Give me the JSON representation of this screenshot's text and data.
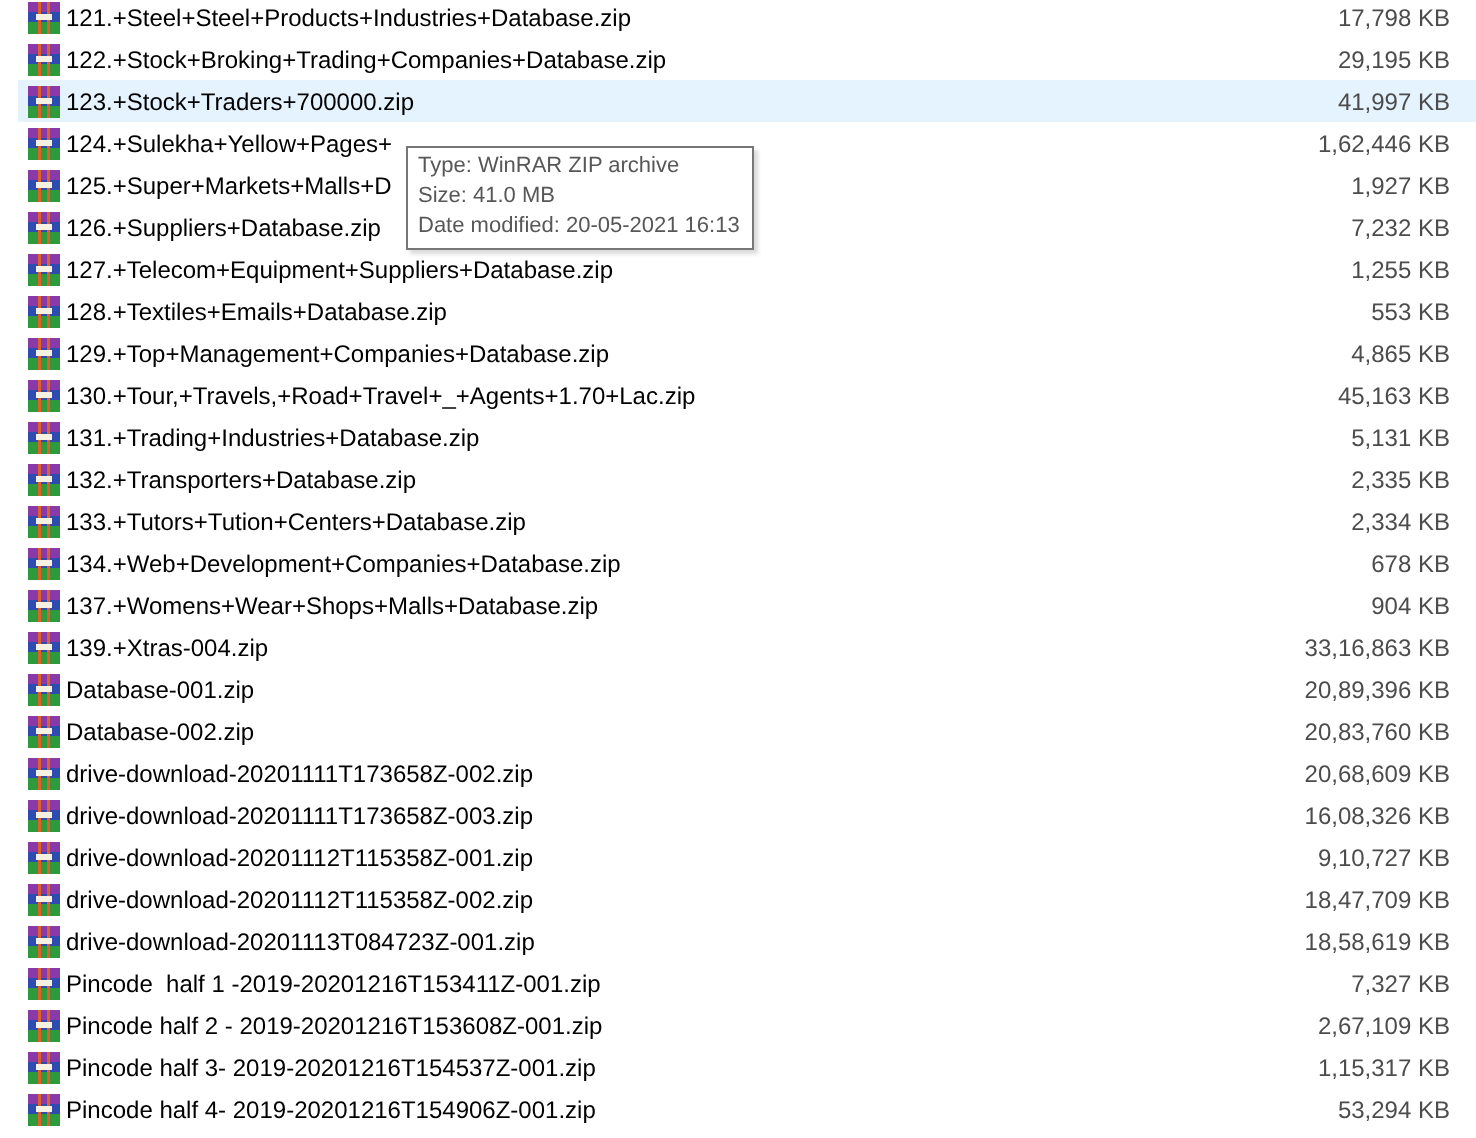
{
  "files": [
    {
      "name": "121.+Steel+Steel+Products+Industries+Database.zip",
      "size": "17,798 KB",
      "selected": false
    },
    {
      "name": "122.+Stock+Broking+Trading+Companies+Database.zip",
      "size": "29,195 KB",
      "selected": false
    },
    {
      "name": "123.+Stock+Traders+700000.zip",
      "size": "41,997 KB",
      "selected": true
    },
    {
      "name": "124.+Sulekha+Yellow+Pages+",
      "size": "1,62,446 KB",
      "selected": false
    },
    {
      "name": "125.+Super+Markets+Malls+D",
      "size": "1,927 KB",
      "selected": false
    },
    {
      "name": "126.+Suppliers+Database.zip",
      "size": "7,232 KB",
      "selected": false
    },
    {
      "name": "127.+Telecom+Equipment+Suppliers+Database.zip",
      "size": "1,255 KB",
      "selected": false
    },
    {
      "name": "128.+Textiles+Emails+Database.zip",
      "size": "553 KB",
      "selected": false
    },
    {
      "name": "129.+Top+Management+Companies+Database.zip",
      "size": "4,865 KB",
      "selected": false
    },
    {
      "name": "130.+Tour,+Travels,+Road+Travel+_+Agents+1.70+Lac.zip",
      "size": "45,163 KB",
      "selected": false
    },
    {
      "name": "131.+Trading+Industries+Database.zip",
      "size": "5,131 KB",
      "selected": false
    },
    {
      "name": "132.+Transporters+Database.zip",
      "size": "2,335 KB",
      "selected": false
    },
    {
      "name": "133.+Tutors+Tution+Centers+Database.zip",
      "size": "2,334 KB",
      "selected": false
    },
    {
      "name": "134.+Web+Development+Companies+Database.zip",
      "size": "678 KB",
      "selected": false
    },
    {
      "name": "137.+Womens+Wear+Shops+Malls+Database.zip",
      "size": "904 KB",
      "selected": false
    },
    {
      "name": "139.+Xtras-004.zip",
      "size": "33,16,863 KB",
      "selected": false
    },
    {
      "name": "Database-001.zip",
      "size": "20,89,396 KB",
      "selected": false
    },
    {
      "name": "Database-002.zip",
      "size": "20,83,760 KB",
      "selected": false
    },
    {
      "name": "drive-download-20201111T173658Z-002.zip",
      "size": "20,68,609 KB",
      "selected": false
    },
    {
      "name": "drive-download-20201111T173658Z-003.zip",
      "size": "16,08,326 KB",
      "selected": false
    },
    {
      "name": "drive-download-20201112T115358Z-001.zip",
      "size": "9,10,727 KB",
      "selected": false
    },
    {
      "name": "drive-download-20201112T115358Z-002.zip",
      "size": "18,47,709 KB",
      "selected": false
    },
    {
      "name": "drive-download-20201113T084723Z-001.zip",
      "size": "18,58,619 KB",
      "selected": false
    },
    {
      "name": "Pincode  half 1 -2019-20201216T153411Z-001.zip",
      "size": "7,327 KB",
      "selected": false
    },
    {
      "name": "Pincode half 2 - 2019-20201216T153608Z-001.zip",
      "size": "2,67,109 KB",
      "selected": false
    },
    {
      "name": "Pincode half 3- 2019-20201216T154537Z-001.zip",
      "size": "1,15,317 KB",
      "selected": false
    },
    {
      "name": "Pincode half 4- 2019-20201216T154906Z-001.zip",
      "size": "53,294 KB",
      "selected": false
    }
  ],
  "tooltip": {
    "lines": [
      "Type: WinRAR ZIP archive",
      "Size: 41.0 MB",
      "Date modified: 20-05-2021 16:13"
    ]
  }
}
